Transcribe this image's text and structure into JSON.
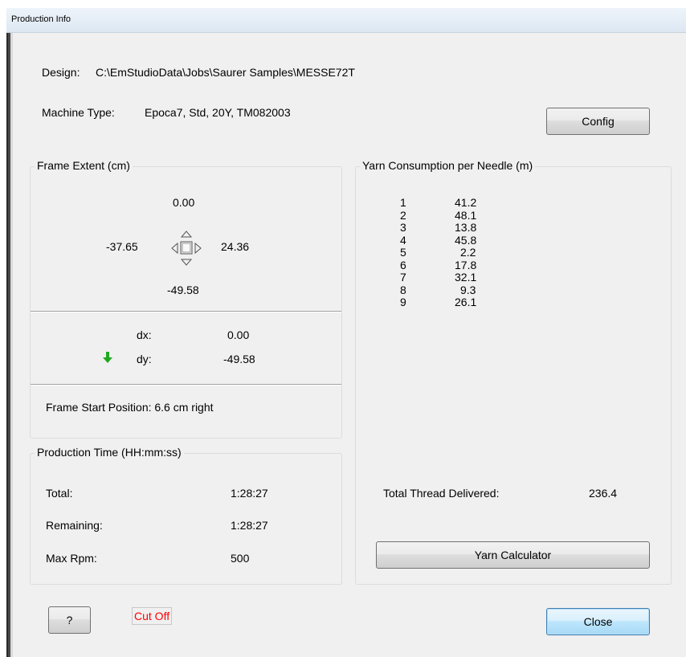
{
  "window": {
    "title": "Production Info"
  },
  "design": {
    "label": "Design:",
    "value": "C:\\EmStudioData\\Jobs\\Saurer Samples\\MESSE72T"
  },
  "machine": {
    "label": "Machine Type:",
    "value": "Epoca7, Std, 20Y, TM082003"
  },
  "buttons": {
    "config": "Config",
    "yarn_calculator": "Yarn Calculator",
    "help": "?",
    "close": "Close"
  },
  "frame_extent": {
    "title": "Frame Extent  (cm)",
    "top": "0.00",
    "left": "-37.65",
    "right": "24.36",
    "bottom": "-49.58",
    "dx_label": "dx:",
    "dx_value": "0.00",
    "dy_label": "dy:",
    "dy_value": "-49.58",
    "start_position": "Frame Start Position:  6.6 cm right"
  },
  "production_time": {
    "title": "Production Time  (HH:mm:ss)",
    "rows": [
      {
        "label": "Total:",
        "value": "1:28:27"
      },
      {
        "label": "Remaining:",
        "value": "1:28:27"
      },
      {
        "label": "Max Rpm:",
        "value": "500"
      }
    ]
  },
  "yarn": {
    "title": "Yarn Consumption per Needle  (m)",
    "needles": [
      {
        "needle": "1",
        "value": "41.2"
      },
      {
        "needle": "2",
        "value": "48.1"
      },
      {
        "needle": "3",
        "value": "13.8"
      },
      {
        "needle": "4",
        "value": "45.8"
      },
      {
        "needle": "5",
        "value": "2.2"
      },
      {
        "needle": "6",
        "value": "17.8"
      },
      {
        "needle": "7",
        "value": "32.1"
      },
      {
        "needle": "8",
        "value": "9.3"
      },
      {
        "needle": "9",
        "value": "26.1"
      }
    ],
    "total_label": "Total Thread Delivered:",
    "total_value": "236.4"
  },
  "status": {
    "cut_off": "Cut Off"
  },
  "colors": {
    "cut_off_text": "#ff0000",
    "dy_arrow": "#1fa81f"
  },
  "icons": {
    "frame_move": "frame-move-arrows-icon",
    "dy_arrow": "green-down-arrow-icon"
  }
}
